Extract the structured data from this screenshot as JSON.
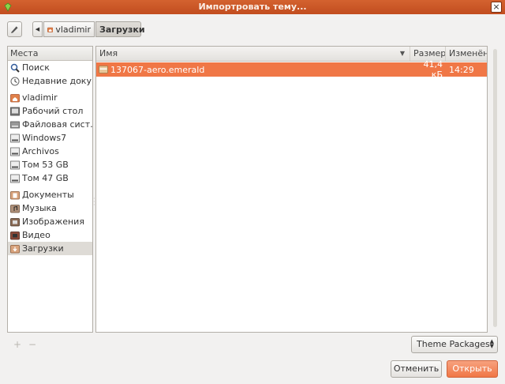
{
  "window": {
    "title": "Импортровать тему...",
    "close": "×"
  },
  "toolbar": {
    "back": "◀",
    "path": [
      "vladimir",
      "Загрузки"
    ]
  },
  "sidebar": {
    "header": "Места",
    "items": [
      {
        "label": "Поиск",
        "icon": "search-icon"
      },
      {
        "label": "Недавние доку…",
        "icon": "recent-icon"
      },
      {
        "label": "vladimir",
        "icon": "home-folder-icon"
      },
      {
        "label": "Рабочий стол",
        "icon": "desktop-icon"
      },
      {
        "label": "Файловая сист…",
        "icon": "filesystem-icon"
      },
      {
        "label": "Windows7",
        "icon": "drive-icon"
      },
      {
        "label": "Archivos",
        "icon": "drive-icon"
      },
      {
        "label": "Том 53 GB",
        "icon": "drive-icon"
      },
      {
        "label": "Том 47 GB",
        "icon": "drive-icon"
      },
      {
        "label": "Документы",
        "icon": "documents-folder-icon"
      },
      {
        "label": "Музыка",
        "icon": "music-folder-icon"
      },
      {
        "label": "Изображения",
        "icon": "pictures-folder-icon"
      },
      {
        "label": "Видео",
        "icon": "video-folder-icon"
      },
      {
        "label": "Загрузки",
        "icon": "downloads-folder-icon"
      }
    ],
    "add": "+",
    "remove": "−"
  },
  "filelist": {
    "columns": {
      "name": "Имя",
      "size": "Размер",
      "modified": "Изменён"
    },
    "rows": [
      {
        "name": "137067-aero.emerald",
        "size": "41,4 кБ",
        "modified": "14:29"
      }
    ]
  },
  "filter": {
    "value": "Theme Packages"
  },
  "buttons": {
    "cancel": "Отменить",
    "open": "Открыть"
  },
  "colors": {
    "accent": "#f07746",
    "titlebar": "#c24d1f"
  }
}
